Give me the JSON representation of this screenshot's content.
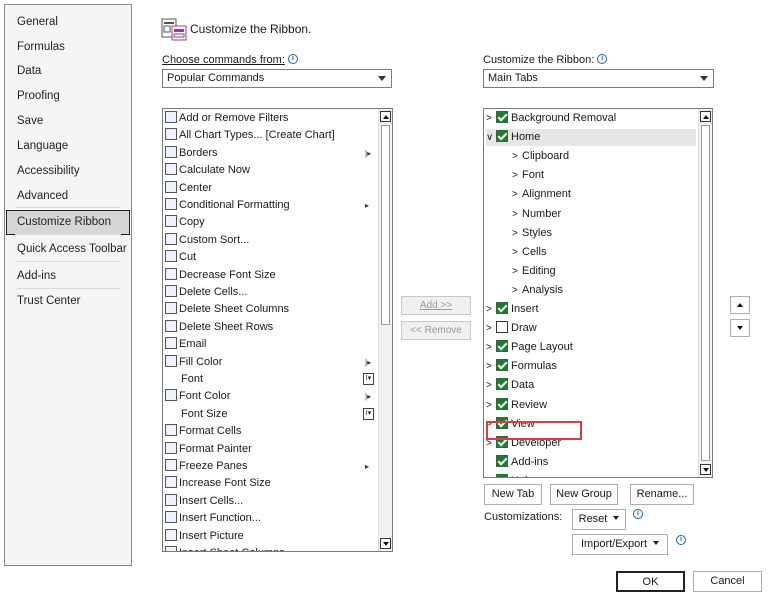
{
  "nav": [
    "General",
    "Formulas",
    "Data",
    "Proofing",
    "Save",
    "Language",
    "Accessibility",
    "Advanced",
    "Customize Ribbon",
    "Quick Access Toolbar",
    "Add-ins",
    "Trust Center"
  ],
  "nav_selected": "Customize Ribbon",
  "header": {
    "title": "Customize the Ribbon."
  },
  "left": {
    "label": "Choose commands from:",
    "info": "i",
    "combo_value": "Popular Commands",
    "commands": [
      {
        "label": "Add or Remove Filters",
        "icon": "filter-icon"
      },
      {
        "label": "All Chart Types... [Create Chart]",
        "icon": "chart-icon"
      },
      {
        "label": "Borders",
        "icon": "borders-icon",
        "submenu": "|▸"
      },
      {
        "label": "Calculate Now",
        "icon": "calculator-icon"
      },
      {
        "label": "Center",
        "icon": "center-align-icon"
      },
      {
        "label": "Conditional Formatting",
        "icon": "conditional-formatting-icon",
        "submenu": "▸"
      },
      {
        "label": "Copy",
        "icon": "copy-icon"
      },
      {
        "label": "Custom Sort...",
        "icon": "sort-icon"
      },
      {
        "label": "Cut",
        "icon": "scissors-icon"
      },
      {
        "label": "Decrease Font Size",
        "icon": "font-decrease-icon"
      },
      {
        "label": "Delete Cells...",
        "icon": "delete-cells-icon"
      },
      {
        "label": "Delete Sheet Columns",
        "icon": "delete-columns-icon"
      },
      {
        "label": "Delete Sheet Rows",
        "icon": "delete-rows-icon"
      },
      {
        "label": "Email",
        "icon": "email-icon"
      },
      {
        "label": "Fill Color",
        "icon": "fill-color-icon",
        "submenu": "|▸"
      },
      {
        "label": "Font",
        "icon": "",
        "box": "I▾"
      },
      {
        "label": "Font Color",
        "icon": "font-color-icon",
        "submenu": "|▸"
      },
      {
        "label": "Font Size",
        "icon": "",
        "box": "I▾"
      },
      {
        "label": "Format Cells",
        "icon": "format-cells-icon"
      },
      {
        "label": "Format Painter",
        "icon": "format-painter-icon"
      },
      {
        "label": "Freeze Panes",
        "icon": "freeze-panes-icon",
        "submenu": "▸"
      },
      {
        "label": "Increase Font Size",
        "icon": "font-increase-icon"
      },
      {
        "label": "Insert Cells...",
        "icon": "insert-cells-icon"
      },
      {
        "label": "Insert Function...",
        "icon": "function-icon"
      },
      {
        "label": "Insert Picture",
        "icon": "picture-icon"
      },
      {
        "label": "Insert Sheet Columns",
        "icon": "insert-columns-icon"
      }
    ]
  },
  "middle": {
    "add": "Add >>",
    "remove": "<< Remove"
  },
  "right": {
    "label": "Customize the Ribbon:",
    "info": "i",
    "combo_value": "Main Tabs",
    "tabs": [
      {
        "label": "Background Removal",
        "level": 0,
        "chev": ">",
        "checked": true
      },
      {
        "label": "Home",
        "level": 0,
        "chev": "∨",
        "checked": true,
        "selected": true
      },
      {
        "label": "Clipboard",
        "level": 1,
        "chev": ">"
      },
      {
        "label": "Font",
        "level": 1,
        "chev": ">"
      },
      {
        "label": "Alignment",
        "level": 1,
        "chev": ">"
      },
      {
        "label": "Number",
        "level": 1,
        "chev": ">"
      },
      {
        "label": "Styles",
        "level": 1,
        "chev": ">"
      },
      {
        "label": "Cells",
        "level": 1,
        "chev": ">"
      },
      {
        "label": "Editing",
        "level": 1,
        "chev": ">"
      },
      {
        "label": "Analysis",
        "level": 1,
        "chev": ">"
      },
      {
        "label": "Insert",
        "level": 0,
        "chev": ">",
        "checked": true
      },
      {
        "label": "Draw",
        "level": 0,
        "chev": ">",
        "checked": false
      },
      {
        "label": "Page Layout",
        "level": 0,
        "chev": ">",
        "checked": true
      },
      {
        "label": "Formulas",
        "level": 0,
        "chev": ">",
        "checked": true
      },
      {
        "label": "Data",
        "level": 0,
        "chev": ">",
        "checked": true
      },
      {
        "label": "Review",
        "level": 0,
        "chev": ">",
        "checked": true
      },
      {
        "label": "View",
        "level": 0,
        "chev": ">",
        "checked": true
      },
      {
        "label": "Developer",
        "level": 0,
        "chev": ">",
        "checked": true
      },
      {
        "label": "Add-ins",
        "level": 0,
        "chev": "",
        "checked": true
      },
      {
        "label": "Help",
        "level": 0,
        "chev": ">",
        "checked": true
      }
    ],
    "buttons": {
      "new_tab": "New Tab",
      "new_group": "New Group",
      "rename": "Rename..."
    },
    "customizations_label": "Customizations:",
    "reset": "Reset",
    "import_export": "Import/Export"
  },
  "footer": {
    "ok": "OK",
    "cancel": "Cancel"
  },
  "colors": {
    "highlight": "#e03a3a",
    "check_green": "#1e7a34"
  }
}
